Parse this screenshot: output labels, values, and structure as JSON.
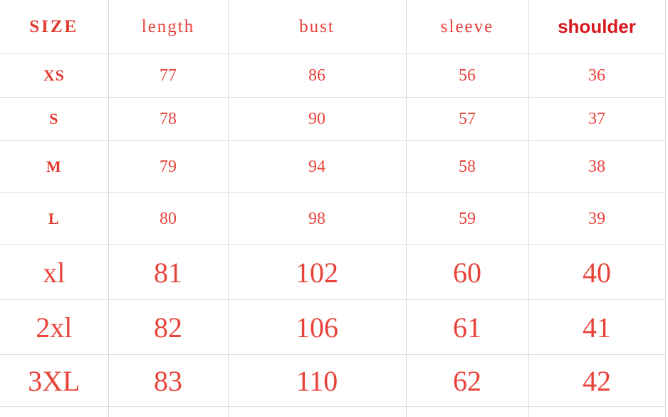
{
  "chart_data": {
    "type": "table",
    "title": "",
    "columns": [
      "SIZE",
      "length",
      "bust",
      "sleeve",
      "shoulder"
    ],
    "rows": [
      {
        "size": "XS",
        "length": "77",
        "bust": "86",
        "sleeve": "56",
        "shoulder": "36"
      },
      {
        "size": "S",
        "length": "78",
        "bust": "90",
        "sleeve": "57",
        "shoulder": "37"
      },
      {
        "size": "M",
        "length": "79",
        "bust": "94",
        "sleeve": "58",
        "shoulder": "38"
      },
      {
        "size": "L",
        "length": "80",
        "bust": "98",
        "sleeve": "59",
        "shoulder": "39"
      },
      {
        "size": "xl",
        "length": "81",
        "bust": "102",
        "sleeve": "60",
        "shoulder": "40"
      },
      {
        "size": "2xl",
        "length": "82",
        "bust": "106",
        "sleeve": "61",
        "shoulder": "41"
      },
      {
        "size": "3XL",
        "length": "83",
        "bust": "110",
        "sleeve": "62",
        "shoulder": "42"
      }
    ]
  },
  "table": {
    "header": {
      "size": "SIZE",
      "length": "length",
      "bust": "bust",
      "sleeve": "sleeve",
      "shoulder": "shoulder"
    },
    "rows": [
      {
        "size": "XS",
        "length": "77",
        "bust": "86",
        "sleeve": "56",
        "shoulder": "36"
      },
      {
        "size": "S",
        "length": "78",
        "bust": "90",
        "sleeve": "57",
        "shoulder": "37"
      },
      {
        "size": "M",
        "length": "79",
        "bust": "94",
        "sleeve": "58",
        "shoulder": "38"
      },
      {
        "size": "L",
        "length": "80",
        "bust": "98",
        "sleeve": "59",
        "shoulder": "39"
      },
      {
        "size": "xl",
        "length": "81",
        "bust": "102",
        "sleeve": "60",
        "shoulder": "40"
      },
      {
        "size": "2xl",
        "length": "82",
        "bust": "106",
        "sleeve": "61",
        "shoulder": "41"
      },
      {
        "size": "3XL",
        "length": "83",
        "bust": "110",
        "sleeve": "62",
        "shoulder": "42"
      }
    ]
  },
  "colors": {
    "text_red": "#e8433a",
    "header_red": "#d81920",
    "gridline": "#dcdcdc",
    "background": "#ffffff"
  }
}
